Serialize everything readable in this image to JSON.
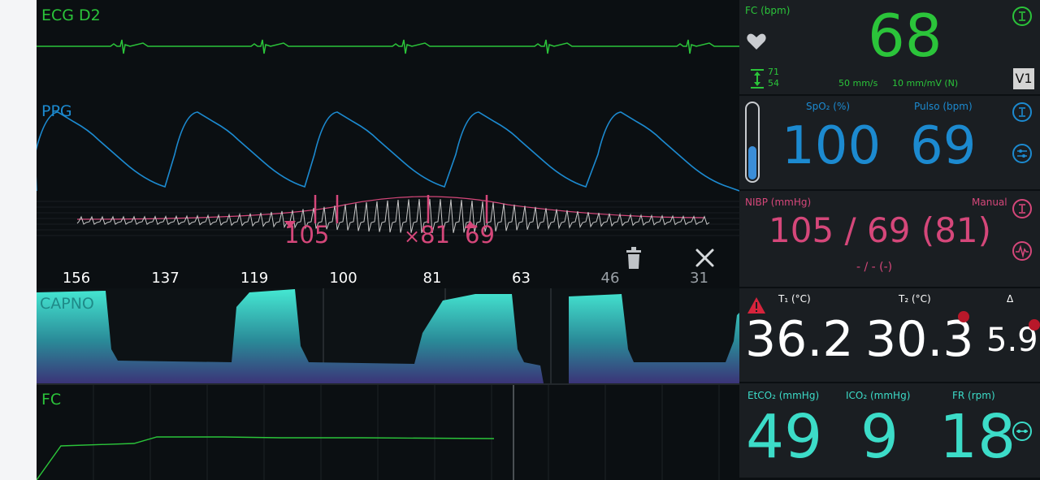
{
  "colors": {
    "ecg": "#2bc43a",
    "ppg": "#1c8ad0",
    "nibp": "#d5477a",
    "capno": "#3cdcc8",
    "fc": "#2bc43a",
    "white": "#ffffff",
    "panel": "#1a1e22",
    "background": "#0b0f12"
  },
  "waveforms": {
    "ecg": {
      "label": "ECG D2"
    },
    "ppg": {
      "label": "PPG"
    },
    "nibp_review": {
      "systolic": "105",
      "mean": "81",
      "diastolic": "69",
      "scale": [
        "156",
        "137",
        "119",
        "100",
        "81",
        "63",
        "46",
        "31"
      ],
      "delete_icon": "trash-icon",
      "close_icon": "close-icon"
    },
    "capno": {
      "label": "CAPNO"
    },
    "fc_trend": {
      "label": "FC"
    }
  },
  "fc_panel": {
    "label": "FC (bpm)",
    "value": "68",
    "limit_high": "71",
    "limit_low": "54",
    "speed": "50 mm/s",
    "gain": "10 mm/mV (N)",
    "lead": "V1"
  },
  "spo2_panel": {
    "spo2_label": "SpO₂ (%)",
    "spo2_value": "100",
    "pulse_label": "Pulso (bpm)",
    "pulse_value": "69",
    "signal_level": 0.45
  },
  "nibp_panel": {
    "label": "NIBP (mmHg)",
    "mode": "Manual",
    "value": "105 / 69 (81)",
    "previous": "- / - (-)"
  },
  "temp_panel": {
    "t1_label": "T₁ (°C)",
    "t1_value": "36.2",
    "t2_label": "T₂ (°C)",
    "t2_value": "30.3",
    "delta_label": "Δ",
    "delta_value": "5.9"
  },
  "co2_panel": {
    "etco2_label": "EtCO₂ (mmHg)",
    "etco2_value": "49",
    "ico2_label": "ICO₂ (mmHg)",
    "ico2_value": "9",
    "fr_label": "FR (rpm)",
    "fr_value": "18"
  }
}
